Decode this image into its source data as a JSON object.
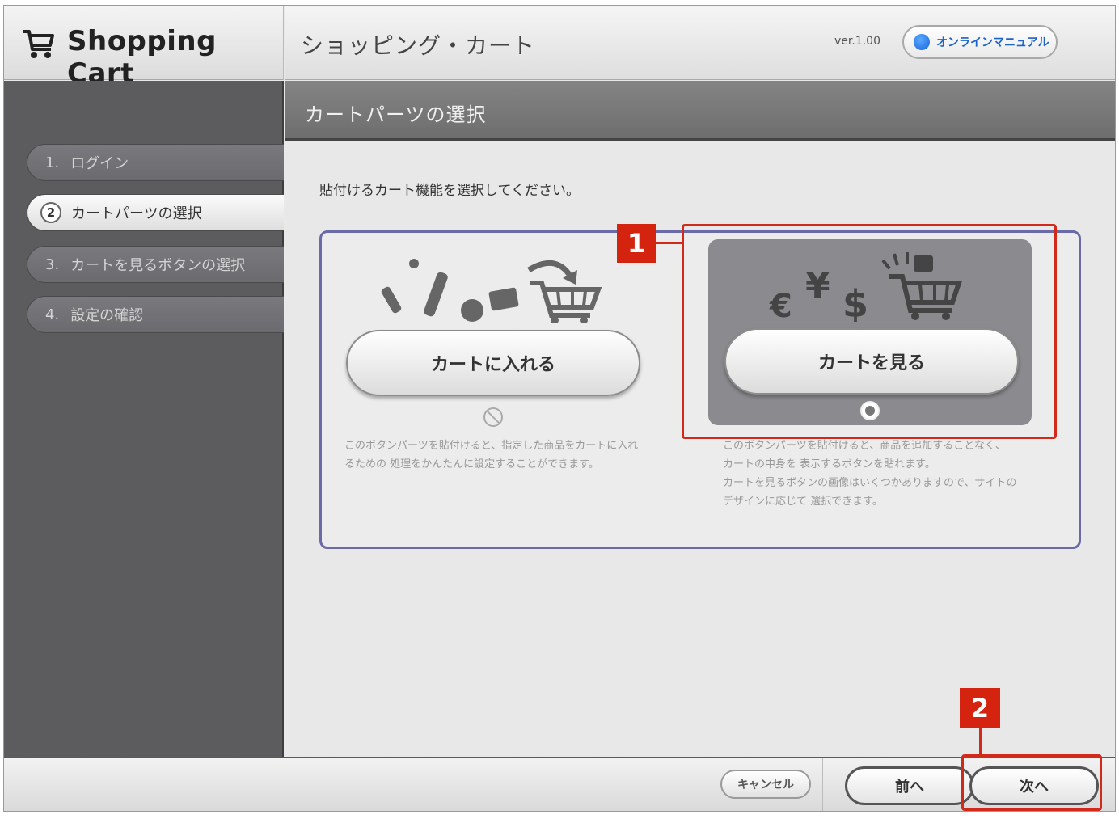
{
  "app": {
    "logo_icon": "shopping-cart-icon",
    "name": "Shopping Cart",
    "title": "ショッピング・カート",
    "version": "ver.1.00",
    "manual_label": "オンラインマニュアル"
  },
  "sidebar": {
    "items": [
      {
        "num": "1.",
        "label": "ログイン",
        "active": false
      },
      {
        "num": "2",
        "label": "カートパーツの選択",
        "active": true
      },
      {
        "num": "3.",
        "label": "カートを見るボタンの選択",
        "active": false
      },
      {
        "num": "4.",
        "label": "設定の確認",
        "active": false
      }
    ]
  },
  "section": {
    "title": "カートパーツの選択",
    "instruction": "貼付けるカート機能を選択してください。"
  },
  "options": [
    {
      "label": "カートに入れる",
      "illustration": "items-into-cart-icon",
      "selected": false,
      "description": [
        "このボタンパーツを貼付けると、指定した商品をカートに入れ",
        "るための 処理をかんたんに設定することができます。"
      ]
    },
    {
      "label": "カートを見る",
      "illustration": "currency-cart-icon",
      "selected": true,
      "description": [
        "このボタンパーツを貼付けると、商品を追加することなく、",
        "カートの中身を 表示するボタンを貼れます。",
        "カートを見るボタンの画像はいくつかありますので、サイトの",
        "デザインに応じて 選択できます。"
      ]
    }
  ],
  "callouts": {
    "one": "1",
    "two": "2"
  },
  "footer": {
    "cancel_label": "キャンセル",
    "prev_label": "前へ",
    "next_label": "次へ"
  },
  "colors": {
    "callout": "#d12a1a",
    "sidebar_bg": "#5c5c5f",
    "panel_border": "#6a6aa8",
    "manual_text": "#1d63c8"
  }
}
